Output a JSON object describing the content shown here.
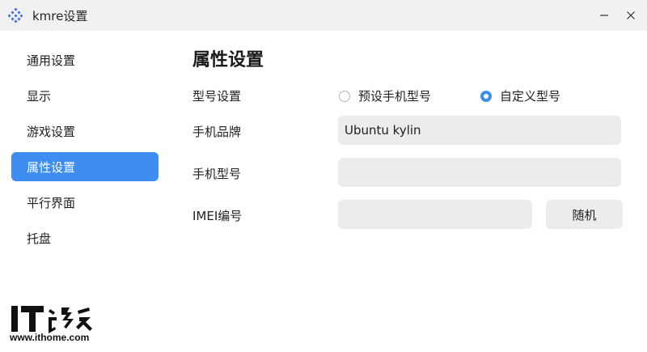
{
  "window": {
    "title": "kmre设置",
    "controls": [
      "minimize-icon",
      "close-icon"
    ]
  },
  "sidebar": {
    "items": [
      {
        "label": "通用设置",
        "active": false
      },
      {
        "label": "显示",
        "active": false
      },
      {
        "label": "游戏设置",
        "active": false
      },
      {
        "label": "属性设置",
        "active": true
      },
      {
        "label": "平行界面",
        "active": false
      },
      {
        "label": "托盘",
        "active": false
      }
    ]
  },
  "main": {
    "title": "属性设置",
    "model_setting": {
      "label": "型号设置",
      "options": [
        {
          "label": "预设手机型号",
          "checked": false
        },
        {
          "label": "自定义型号",
          "checked": true
        }
      ]
    },
    "brand": {
      "label": "手机品牌",
      "value": "Ubuntu kylin"
    },
    "model": {
      "label": "手机型号",
      "value": ""
    },
    "imei": {
      "label": "IMEI编号",
      "value": "",
      "random_button": "随机"
    }
  },
  "watermark": {
    "logo_text": "IT之家",
    "url": "www.ithome.com"
  },
  "colors": {
    "accent": "#3d8ef0",
    "titlebar": "#f1f1f1",
    "input_bg": "#ececec"
  }
}
